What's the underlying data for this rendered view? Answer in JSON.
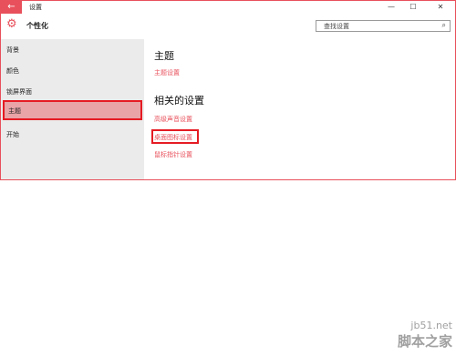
{
  "window": {
    "title": "设置",
    "controls": {
      "minimize": "—",
      "maximize": "☐",
      "close": "✕"
    },
    "back_glyph": "←"
  },
  "header": {
    "icon": "gear-icon",
    "section_title": "个性化",
    "search_placeholder": "查找设置",
    "search_icon_glyph": "⌕"
  },
  "sidebar": {
    "items": [
      {
        "label": "背景",
        "selected": false
      },
      {
        "label": "颜色",
        "selected": false
      },
      {
        "label": "锁屏界面",
        "selected": false
      },
      {
        "label": "主题",
        "selected": true
      },
      {
        "label": "开始",
        "selected": false
      }
    ]
  },
  "content": {
    "heading_theme": "主题",
    "link_theme_settings": "主题设置",
    "heading_related": "相关的设置",
    "links": [
      "高级声音设置",
      "桌面图标设置",
      "鼠标指针设置"
    ]
  },
  "colors": {
    "accent": "#e8505b",
    "selection_bg": "#e8a4a7",
    "highlight_border": "#e51b23",
    "sidebar_bg": "#ebebeb"
  },
  "watermark": {
    "domain": "jb51.net",
    "name": "脚本之家"
  }
}
